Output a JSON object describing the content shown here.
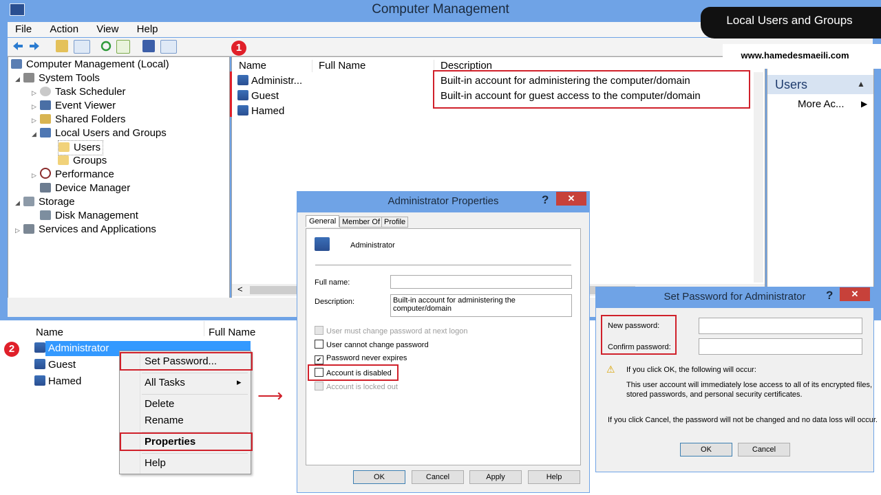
{
  "window": {
    "title": "Computer Management"
  },
  "menu": [
    "File",
    "Action",
    "View",
    "Help"
  ],
  "tree": {
    "root": "Computer Management (Local)",
    "system_tools": "System Tools",
    "task_scheduler": "Task Scheduler",
    "event_viewer": "Event Viewer",
    "shared_folders": "Shared Folders",
    "local_users_groups": "Local Users and Groups",
    "users": "Users",
    "groups": "Groups",
    "performance": "Performance",
    "device_manager": "Device Manager",
    "storage": "Storage",
    "disk_management": "Disk Management",
    "services_apps": "Services and Applications"
  },
  "list": {
    "headers": {
      "name": "Name",
      "full_name": "Full Name",
      "description": "Description"
    },
    "rows": [
      {
        "name": "Administr...",
        "description": "Built-in account for administering the computer/domain"
      },
      {
        "name": "Guest",
        "description": "Built-in account for guest access to the computer/domain"
      },
      {
        "name": "Hamed",
        "description": ""
      }
    ],
    "scroll_left": "<"
  },
  "actions": {
    "header": "Users",
    "more": "More Ac...",
    "more_arrow": "▶",
    "collapse": "▲"
  },
  "banner": {
    "title": "Local Users and Groups",
    "site": "www.hamedesmaeili.com"
  },
  "step_badges": [
    "1",
    "2"
  ],
  "context": {
    "headers": {
      "name": "Name",
      "full_name": "Full Name"
    },
    "users": [
      "Administrator",
      "Guest",
      "Hamed"
    ],
    "menu": {
      "set_password": "Set Password...",
      "all_tasks": "All Tasks",
      "submenu_arrow": "▸",
      "delete": "Delete",
      "rename": "Rename",
      "properties": "Properties",
      "help": "Help"
    }
  },
  "admin_dialog": {
    "title": "Administrator Properties",
    "help": "?",
    "close": "✕",
    "tabs": [
      "General",
      "Member Of",
      "Profile"
    ],
    "user_name": "Administrator",
    "full_name_label": "Full name:",
    "full_name_value": "",
    "description_label": "Description:",
    "description_value": "Built-in account for administering the computer/domain",
    "checks": {
      "must_change": "User must change password at next logon",
      "cannot_change": "User cannot change password",
      "never_expires": "Password never expires",
      "disabled": "Account is disabled",
      "locked": "Account is locked out"
    },
    "buttons": {
      "ok": "OK",
      "cancel": "Cancel",
      "apply": "Apply",
      "help": "Help"
    }
  },
  "password_dialog": {
    "title": "Set Password for Administrator",
    "help": "?",
    "close": "✕",
    "new_password_label": "New password:",
    "confirm_password_label": "Confirm password:",
    "warning_icon": "⚠",
    "warning_heading": "If you click OK, the following will occur:",
    "warning_body_1": "This user account will immediately lose access to all of its encrypted files,",
    "warning_body_2": "stored passwords, and personal security certificates.",
    "cancel_note": "If you click Cancel, the password will not be changed and no data loss will occur.",
    "buttons": {
      "ok": "OK",
      "cancel": "Cancel"
    }
  },
  "arrow": "⟶"
}
